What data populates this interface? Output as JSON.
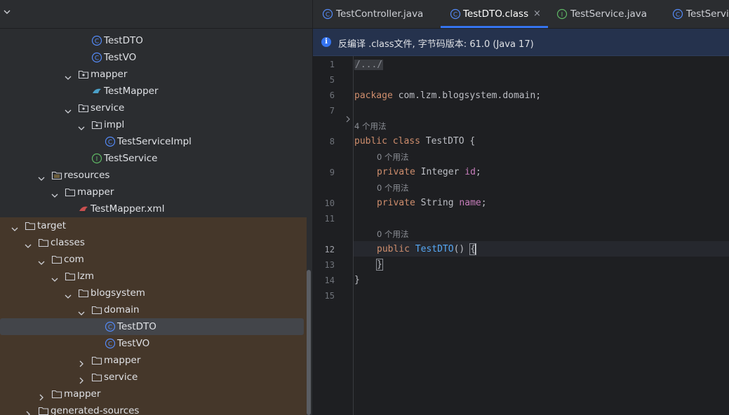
{
  "project_tree": {
    "rows": [
      {
        "label": "TestDTO",
        "icon": "class-icon",
        "depth": "class"
      },
      {
        "label": "TestVO",
        "icon": "class-icon"
      },
      {
        "label": "mapper",
        "icon": "package-icon",
        "expanded": true
      },
      {
        "label": "TestMapper",
        "icon": "mybatis-mapper-icon"
      },
      {
        "label": "service",
        "icon": "package-icon",
        "expanded": true
      },
      {
        "label": "impl",
        "icon": "package-icon",
        "expanded": true
      },
      {
        "label": "TestServiceImpl",
        "icon": "class-icon"
      },
      {
        "label": "TestService",
        "icon": "interface-icon"
      },
      {
        "label": "resources",
        "icon": "resources-folder-icon",
        "expanded": true
      },
      {
        "label": "mapper",
        "icon": "folder-icon",
        "expanded": true
      },
      {
        "label": "TestMapper.xml",
        "icon": "mybatis-xml-icon"
      },
      {
        "label": "target",
        "icon": "folder-icon",
        "expanded": true,
        "excluded": true
      },
      {
        "label": "classes",
        "icon": "folder-icon",
        "expanded": true,
        "excluded": true
      },
      {
        "label": "com",
        "icon": "folder-icon",
        "expanded": true,
        "excluded": true
      },
      {
        "label": "lzm",
        "icon": "folder-icon",
        "expanded": true,
        "excluded": true
      },
      {
        "label": "blogsystem",
        "icon": "folder-icon",
        "expanded": true,
        "excluded": true
      },
      {
        "label": "domain",
        "icon": "folder-icon",
        "expanded": true,
        "excluded": true
      },
      {
        "label": "TestDTO",
        "icon": "class-icon",
        "excluded": true,
        "selected": true
      },
      {
        "label": "TestVO",
        "icon": "class-icon",
        "excluded": true
      },
      {
        "label": "mapper",
        "icon": "folder-icon",
        "expanded": false,
        "excluded": true
      },
      {
        "label": "service",
        "icon": "folder-icon",
        "expanded": false,
        "excluded": true
      },
      {
        "label": "mapper",
        "icon": "folder-icon",
        "expanded": false,
        "excluded": true
      },
      {
        "label": "generated-sources",
        "icon": "folder-icon",
        "expanded": false,
        "excluded": true
      }
    ]
  },
  "tabs": [
    {
      "label": "TestController.java",
      "icon": "class-icon"
    },
    {
      "label": "TestDTO.class",
      "icon": "class-icon",
      "active": true,
      "close": "×"
    },
    {
      "label": "TestService.java",
      "icon": "interface-icon"
    },
    {
      "label": "TestServiceImpl.java",
      "icon": "class-icon"
    }
  ],
  "banner": {
    "icon": "info-icon",
    "glyph": "i",
    "text": "反编译 .class文件, 字节码版本: 61.0 (Java 17)"
  },
  "editor": {
    "line_numbers": [
      "1",
      "5",
      "6",
      "7",
      "8",
      "9",
      "10",
      "11",
      "12",
      "13",
      "14",
      "15"
    ],
    "current_line": "12",
    "code": {
      "fold": "/.../",
      "package_kw": "package",
      "package_name": " com.lzm.blogsystem.domain;",
      "usages_class": "4 个用法",
      "public_kw": "public",
      "class_kw": "class",
      "class_name": " TestDTO {",
      "usages_id": "0 个用法",
      "private_kw": "private",
      "integer_type": " Integer ",
      "id_field": "id",
      "semicolon": ";",
      "usages_name": "0 个用法",
      "string_type": " String ",
      "name_field": "name",
      "usages_ctor": "0 个用法",
      "ctor_name": "TestDTO",
      "ctor_parens": "() ",
      "open_brace": "{",
      "close_brace_inner": "}",
      "close_brace_outer": "}"
    }
  },
  "colors": {
    "background": "#1e1f22",
    "panel": "#2b2d30",
    "excluded_bg": "#45372a",
    "accent": "#3574f0",
    "keyword": "#cf8e6d",
    "field": "#c77dbb",
    "function": "#56a8f5"
  }
}
